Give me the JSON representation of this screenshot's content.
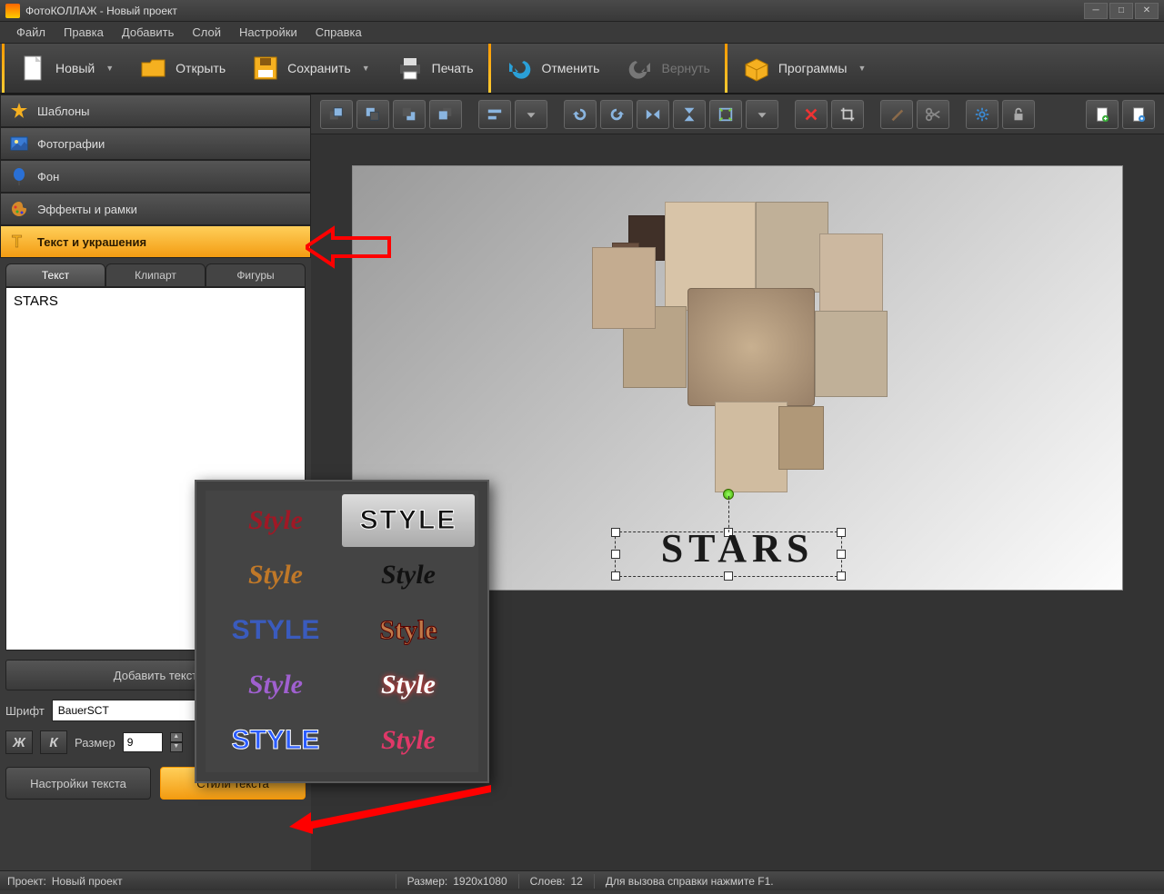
{
  "window": {
    "title": "ФотоКОЛЛАЖ - Новый проект"
  },
  "menubar": [
    "Файл",
    "Правка",
    "Добавить",
    "Слой",
    "Настройки",
    "Справка"
  ],
  "toolbar": {
    "new": "Новый",
    "open": "Открыть",
    "save": "Сохранить",
    "print": "Печать",
    "undo": "Отменить",
    "redo": "Вернуть",
    "programs": "Программы"
  },
  "accordion": {
    "templates": "Шаблоны",
    "photos": "Фотографии",
    "background": "Фон",
    "effects": "Эффекты и рамки",
    "text_deco": "Текст и украшения"
  },
  "text_panel": {
    "tabs": {
      "text": "Текст",
      "clipart": "Клипарт",
      "shapes": "Фигуры"
    },
    "input_value": "STARS",
    "add_text": "Добавить текст",
    "font_label": "Шрифт",
    "font_value": "BauerSCT",
    "size_label": "Размер",
    "size_value": "9",
    "bold": "Ж",
    "italic": "К",
    "text_settings": "Настройки текста",
    "text_styles": "Стили текста"
  },
  "style_popup": {
    "items": [
      {
        "label": "Style",
        "css": "color:#a01825;font-family:serif;font-style:italic"
      },
      {
        "label": "STYLE",
        "css": "color:#111;font-family:sans-serif;letter-spacing:2px;-webkit-text-stroke:1px #fff",
        "selected": true
      },
      {
        "label": "Style",
        "css": "color:#c07828;font-family:serif;font-style:italic"
      },
      {
        "label": "Style",
        "css": "color:#111;font-family:serif;font-style:italic"
      },
      {
        "label": "STYLE",
        "css": "color:#3a5bbd;font-family:sans-serif;font-weight:900"
      },
      {
        "label": "Style",
        "css": "color:#c07848;font-family:cursive;-webkit-text-stroke:1px #500"
      },
      {
        "label": "Style",
        "css": "color:#a060d0;font-family:serif;font-style:italic"
      },
      {
        "label": "Style",
        "css": "color:#fff;font-family:serif;font-style:italic;text-shadow:0 0 6px #f33"
      },
      {
        "label": "STYLE",
        "css": "color:#2b5cff;font-family:sans-serif;font-weight:900;-webkit-text-stroke:1px #fff"
      },
      {
        "label": "Style",
        "css": "color:#e03868;font-family:cursive;font-style:italic"
      }
    ]
  },
  "canvas": {
    "stars_label": "STARS"
  },
  "statusbar": {
    "project_label": "Проект:",
    "project_name": "Новый проект",
    "size_label": "Размер:",
    "size_value": "1920x1080",
    "layers_label": "Слоев:",
    "layers_value": "12",
    "help_hint": "Для вызова справки нажмите F1."
  }
}
